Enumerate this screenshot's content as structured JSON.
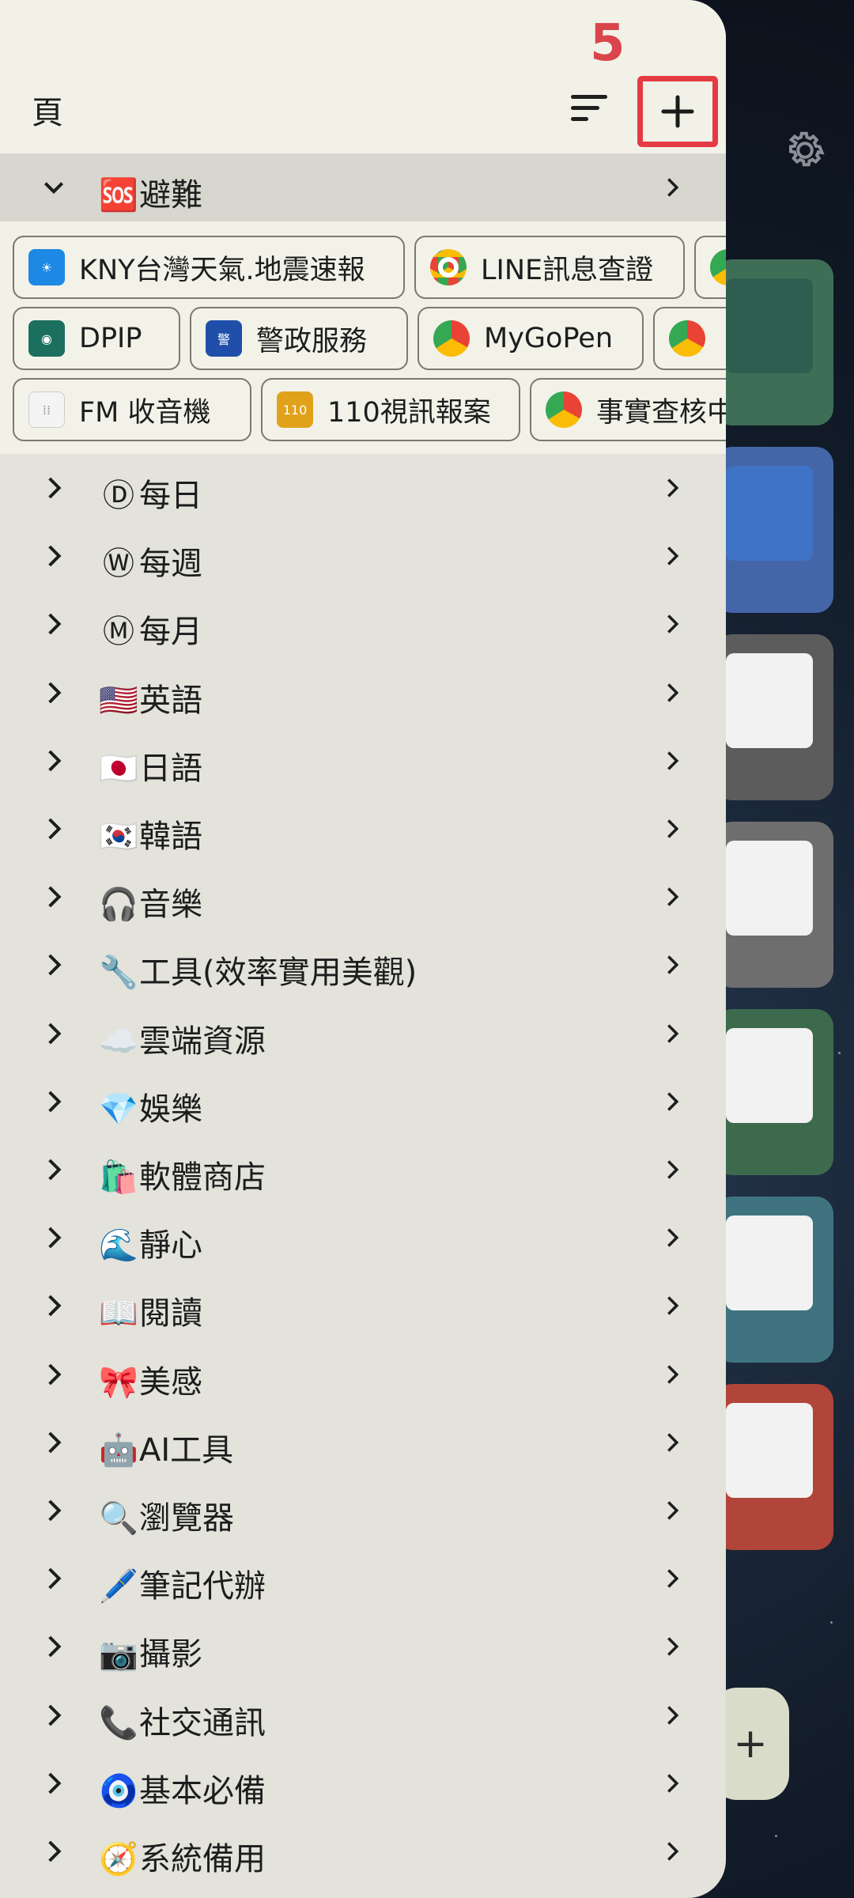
{
  "drawer": {
    "title": "頁",
    "step_badge": "5",
    "expanded_group": {
      "emoji": "🆘",
      "label": "避難"
    },
    "chips": [
      {
        "label": "KNY台灣天氣.地震速報",
        "icon": "kny-weather-icon",
        "color": "#1e88e5"
      },
      {
        "label": "LINE訊息查證",
        "icon": "chrome-icon",
        "color": "#ffffff"
      },
      {
        "label": "",
        "icon": "chrome-icon",
        "color": "#ffffff"
      },
      {
        "label": "DPIP",
        "icon": "dpip-icon",
        "color": "#1b6f5e"
      },
      {
        "label": "警政服務",
        "icon": "police-icon",
        "color": "#1f4fa8"
      },
      {
        "label": "MyGoPen",
        "icon": "chrome-icon",
        "color": "#ffffff"
      },
      {
        "label": "",
        "icon": "chrome-icon",
        "color": "#ffffff"
      },
      {
        "label": "FM 收音機",
        "icon": "radio-icon",
        "color": "#ffffff"
      },
      {
        "label": "110視訊報案",
        "icon": "video-report-icon",
        "color": "#e0a21b"
      },
      {
        "label": "事實查核中",
        "icon": "chrome-icon",
        "color": "#ffffff"
      }
    ],
    "categories": [
      {
        "emoji": "Ⓓ",
        "label": "每日"
      },
      {
        "emoji": "Ⓦ",
        "label": "每週"
      },
      {
        "emoji": "Ⓜ",
        "label": "每月"
      },
      {
        "emoji": "🇺🇸",
        "label": "英語"
      },
      {
        "emoji": "🇯🇵",
        "label": "日語"
      },
      {
        "emoji": "🇰🇷",
        "label": "韓語"
      },
      {
        "emoji": "🎧",
        "label": "音樂"
      },
      {
        "emoji": "🔧",
        "label": "工具(效率實用美觀)"
      },
      {
        "emoji": "☁️",
        "label": "雲端資源"
      },
      {
        "emoji": "💎",
        "label": "娛樂"
      },
      {
        "emoji": "🛍️",
        "label": "軟體商店"
      },
      {
        "emoji": "🌊",
        "label": "靜心"
      },
      {
        "emoji": "📖",
        "label": "閱讀"
      },
      {
        "emoji": "🎀",
        "label": "美感"
      },
      {
        "emoji": "🤖",
        "label": "AI工具"
      },
      {
        "emoji": "🔍",
        "label": "瀏覽器"
      },
      {
        "emoji": "🖊️",
        "label": "筆記代辦"
      },
      {
        "emoji": "📷",
        "label": "攝影"
      },
      {
        "emoji": "📞",
        "label": "社交通訊"
      },
      {
        "emoji": "🧿",
        "label": "基本必備"
      },
      {
        "emoji": "🧭",
        "label": "系統備用"
      }
    ]
  },
  "home": {
    "fab_label": "+",
    "widget_colors": [
      "#3f6e57",
      "#4466a8",
      "#5c5c5c",
      "#6e6e6e",
      "#3d6a4d",
      "#3f7380",
      "#b1453a"
    ]
  },
  "colors": {
    "highlight": "#e53b43",
    "badge": "#d9454a"
  }
}
